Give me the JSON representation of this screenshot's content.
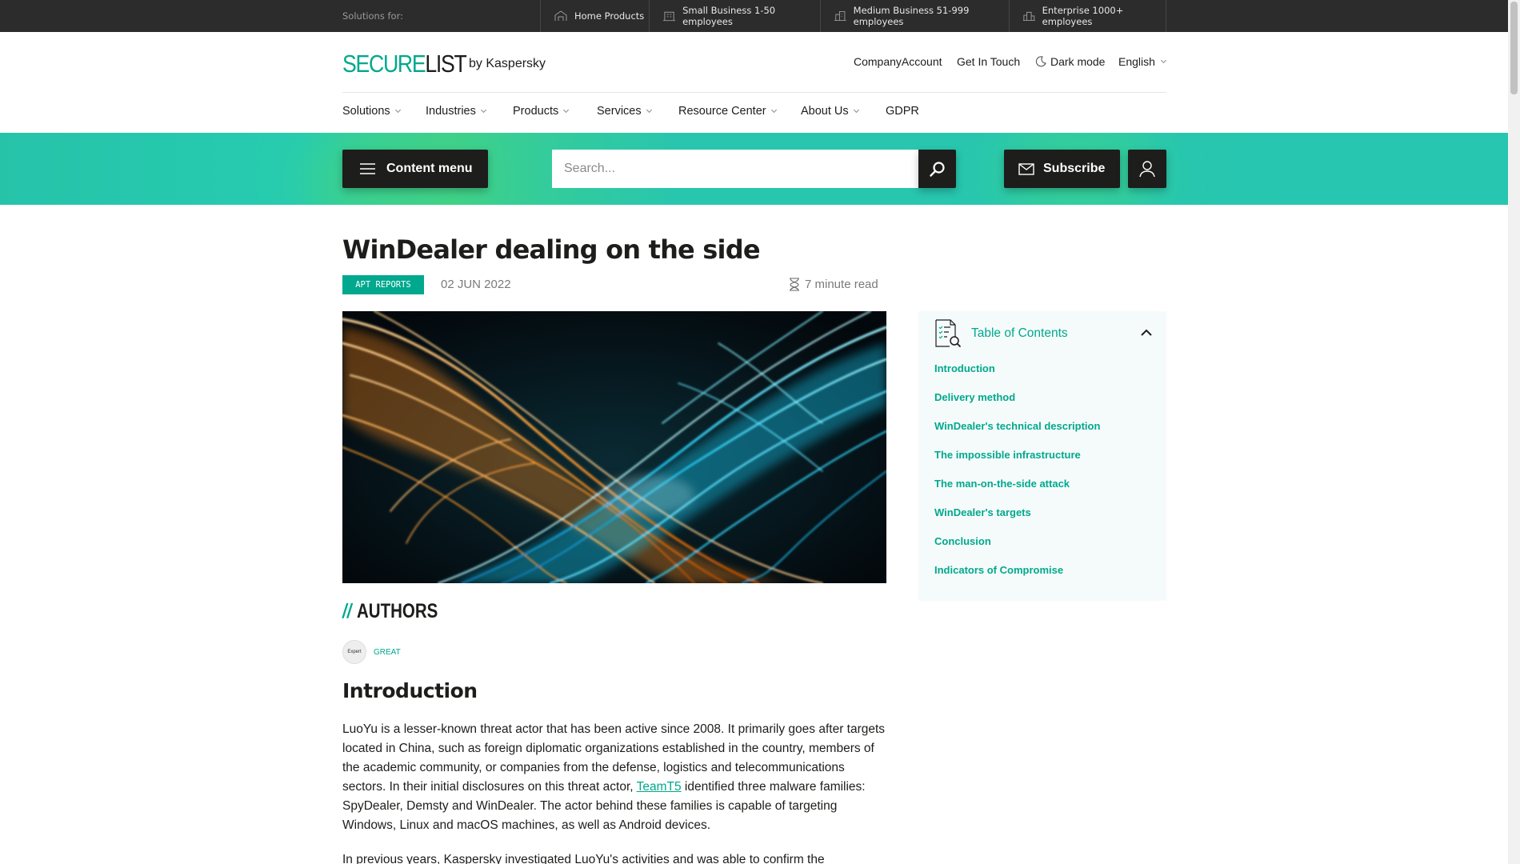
{
  "topbar": {
    "label": "Solutions for:",
    "segments": [
      {
        "label": "Home Products",
        "icon": "home-icon"
      },
      {
        "label": "Small Business 1-50 employees",
        "icon": "small-business-icon"
      },
      {
        "label": "Medium Business 51-999 employees",
        "icon": "medium-business-icon"
      },
      {
        "label": "Enterprise 1000+ employees",
        "icon": "enterprise-icon"
      }
    ]
  },
  "header": {
    "logo_a": "SECURE",
    "logo_b": "LIST",
    "logo_by": "by Kaspersky",
    "links": [
      "CompanyAccount",
      "Get In Touch",
      "Dark mode",
      "English"
    ]
  },
  "nav": [
    "Solutions",
    "Industries",
    "Products",
    "Services",
    "Resource Center",
    "About Us",
    "GDPR"
  ],
  "band": {
    "content_menu": "Content menu",
    "search_placeholder": "Search...",
    "subscribe": "Subscribe"
  },
  "article": {
    "title": "WinDealer dealing on the side",
    "tag": "APT REPORTS",
    "date": "02 JUN 2022",
    "read_time": "7 minute read",
    "authors_heading": "AUTHORS",
    "authors_slash": "//",
    "author_avatar": "Expert",
    "author_name": "GREAT",
    "intro_heading": "Introduction",
    "p1_a": "LuoYu is a lesser-known threat actor that has been active since 2008. It primarily goes after targets located in China, such as foreign diplomatic organizations established in the country, members of the academic community, or companies from the defense, logistics and telecommunications sectors. In their initial disclosures on this threat actor, ",
    "p1_link": "TeamT5",
    "p1_b": " identified three malware families: SpyDealer, Demsty and WinDealer. The actor behind these families is capable of targeting Windows, Linux and macOS machines, as well as Android devices.",
    "p2": "In previous years, Kaspersky investigated LuoYu's activities and was able to confirm the"
  },
  "toc": {
    "title": "Table of Contents",
    "items": [
      "Introduction",
      "Delivery method",
      "WinDealer's technical description",
      "The impossible infrastructure",
      "The man-on-the-side attack",
      "WinDealer's targets",
      "Conclusion",
      "Indicators of Compromise"
    ]
  },
  "colors": {
    "accent": "#00a88e",
    "band": "#27c6b0",
    "dark": "#1d1d1b",
    "topbar": "#2c2c2c"
  }
}
